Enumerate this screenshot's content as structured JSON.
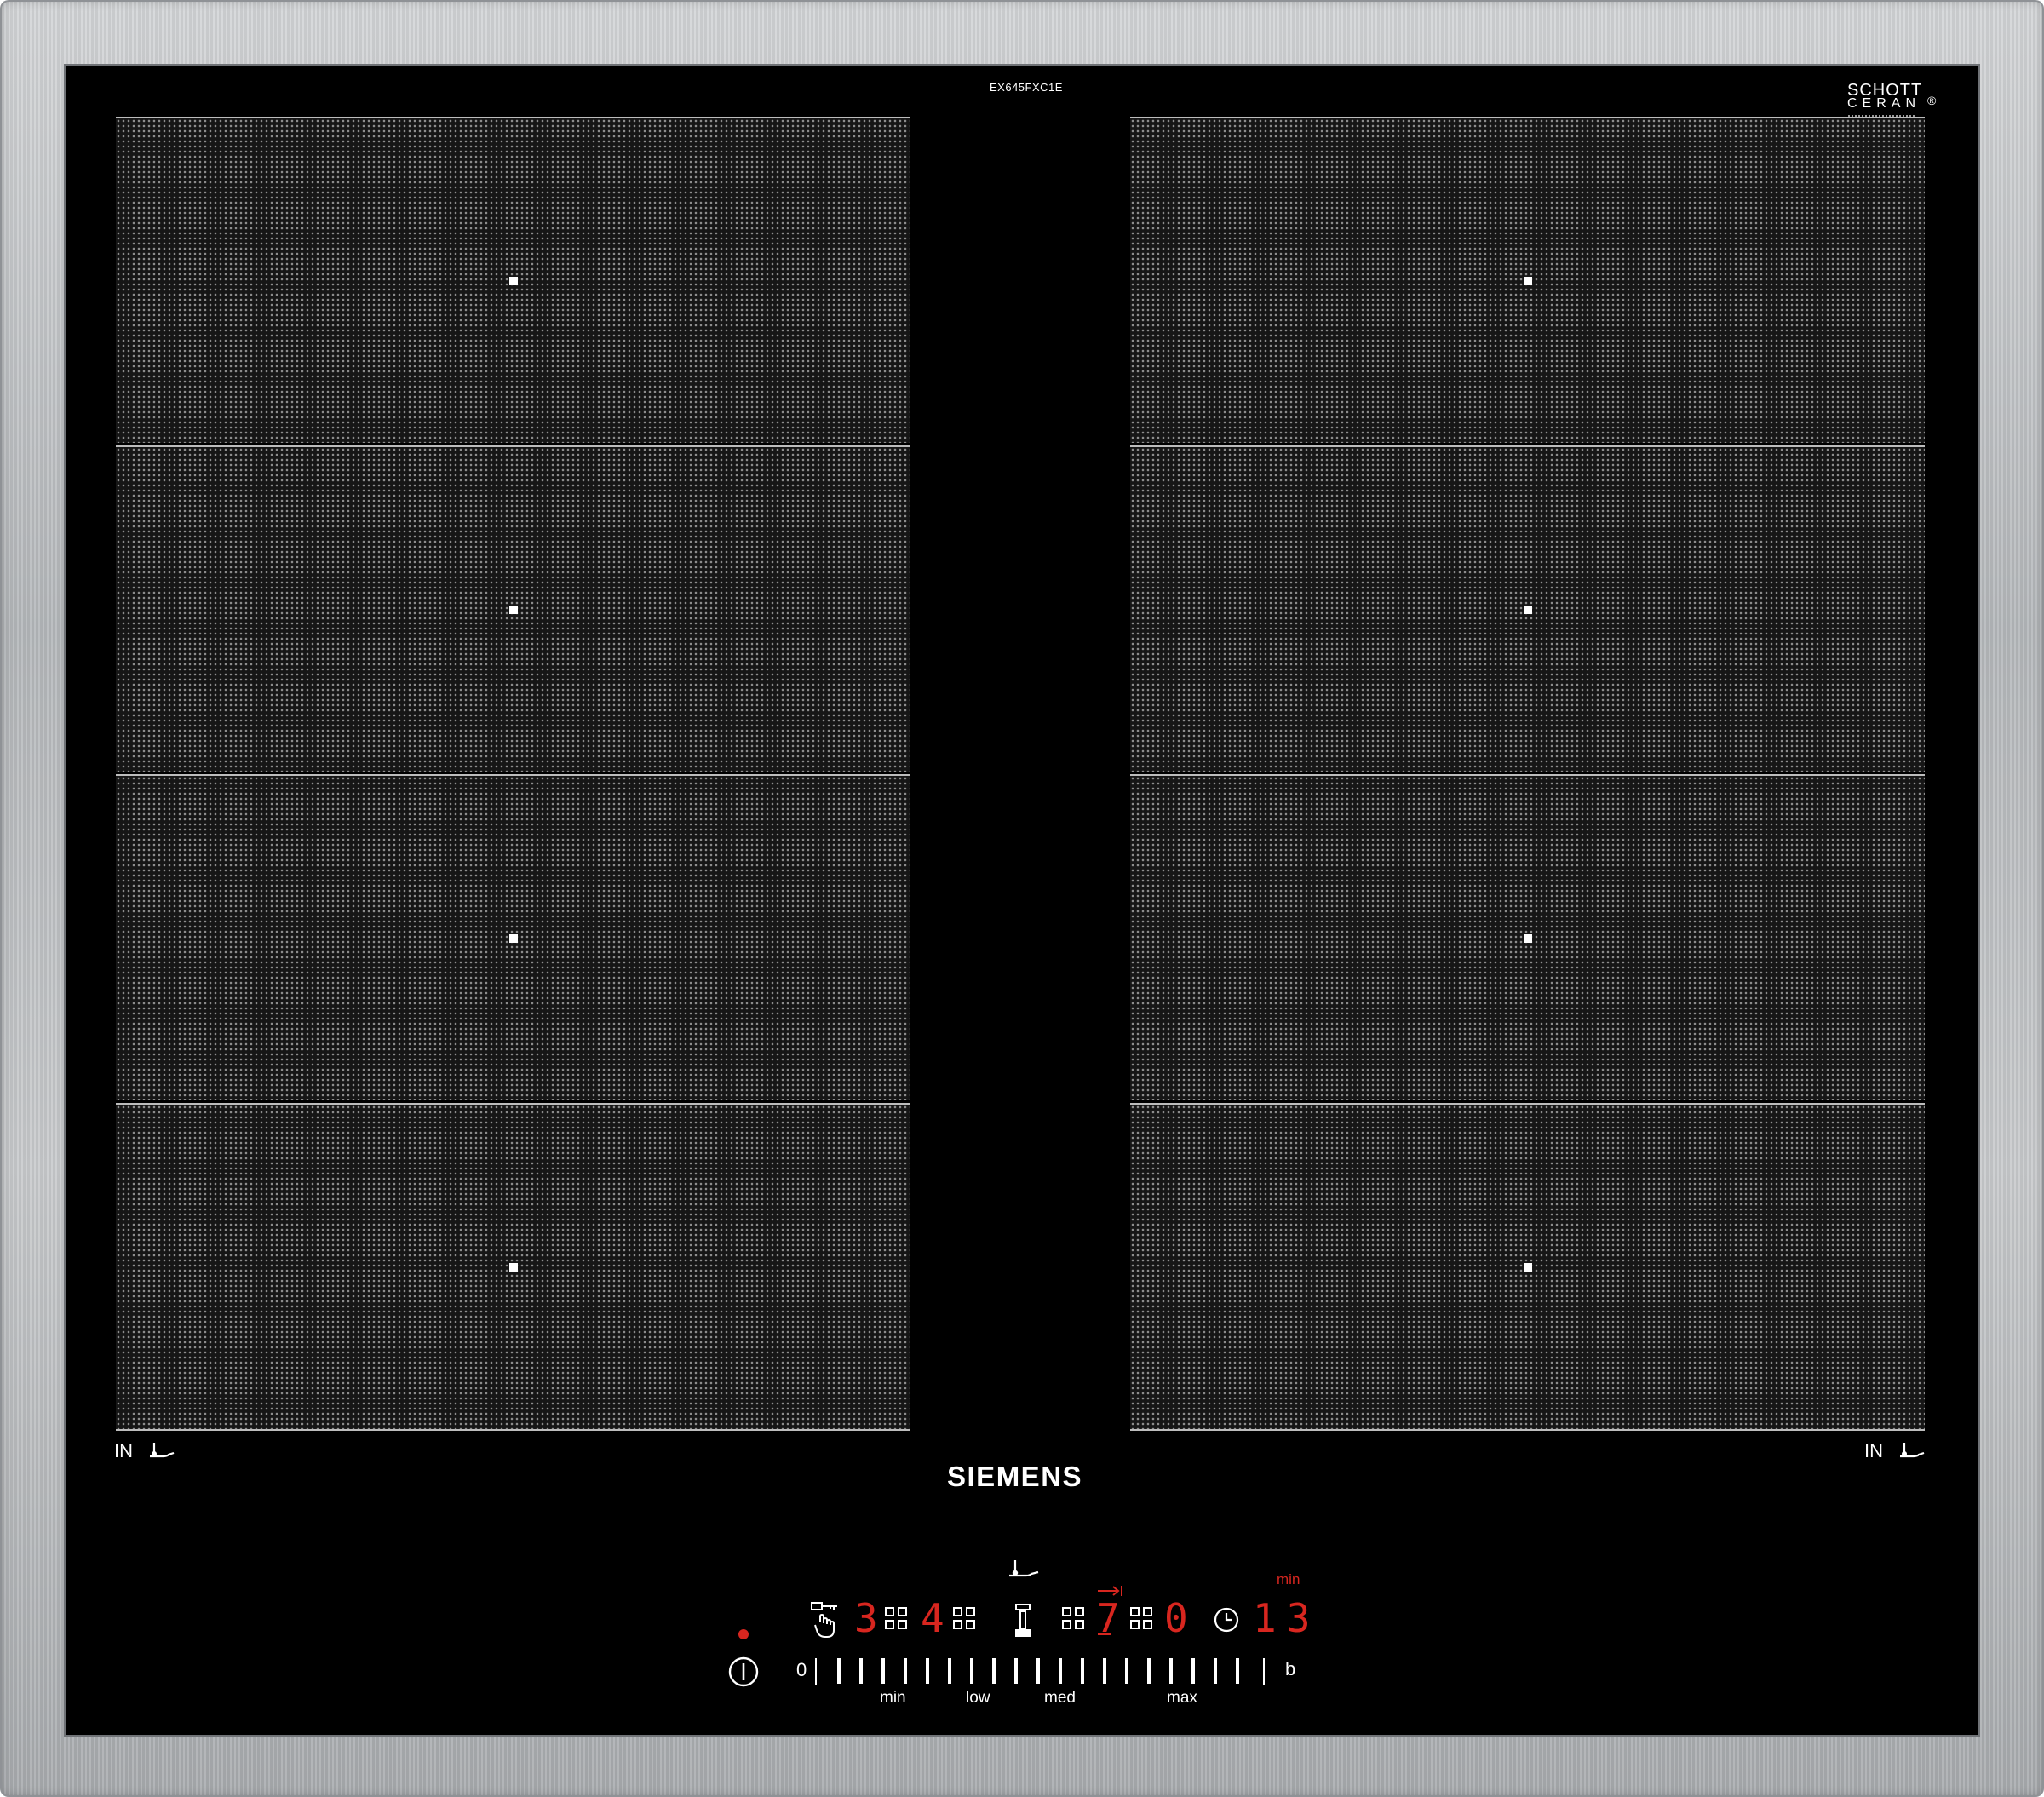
{
  "cooktop": {
    "model_number": "EX645FXC1E",
    "brand": "SIEMENS",
    "glass_brand": {
      "line1": "SCHOTT",
      "line2": "CERAN",
      "mark": "®"
    },
    "left_zone_label": "IN",
    "right_zone_label": "IN",
    "zones": {
      "left_sections": 4,
      "right_sections": 4
    },
    "colors": {
      "glass": "#000000",
      "frame": "#bfc1c3",
      "display_red": "#d8261f",
      "print_white": "#ffffff"
    }
  },
  "control_panel": {
    "power_indicator": "on",
    "digits": {
      "zone_a": "3",
      "zone_b": "4",
      "zone_c": "7",
      "zone_d": "0",
      "timer": "13"
    },
    "timer_unit": "min",
    "slider": {
      "start_label": "0",
      "end_label": "b",
      "labels": [
        "min",
        "low",
        "med",
        "max"
      ],
      "segments": 19
    },
    "icons": [
      "power-icon",
      "child-lock-icon",
      "zone-selector-icon",
      "pan-sensor-icon",
      "combine-zones-icon",
      "timer-clock-icon",
      "timer-arrow-icon"
    ]
  }
}
